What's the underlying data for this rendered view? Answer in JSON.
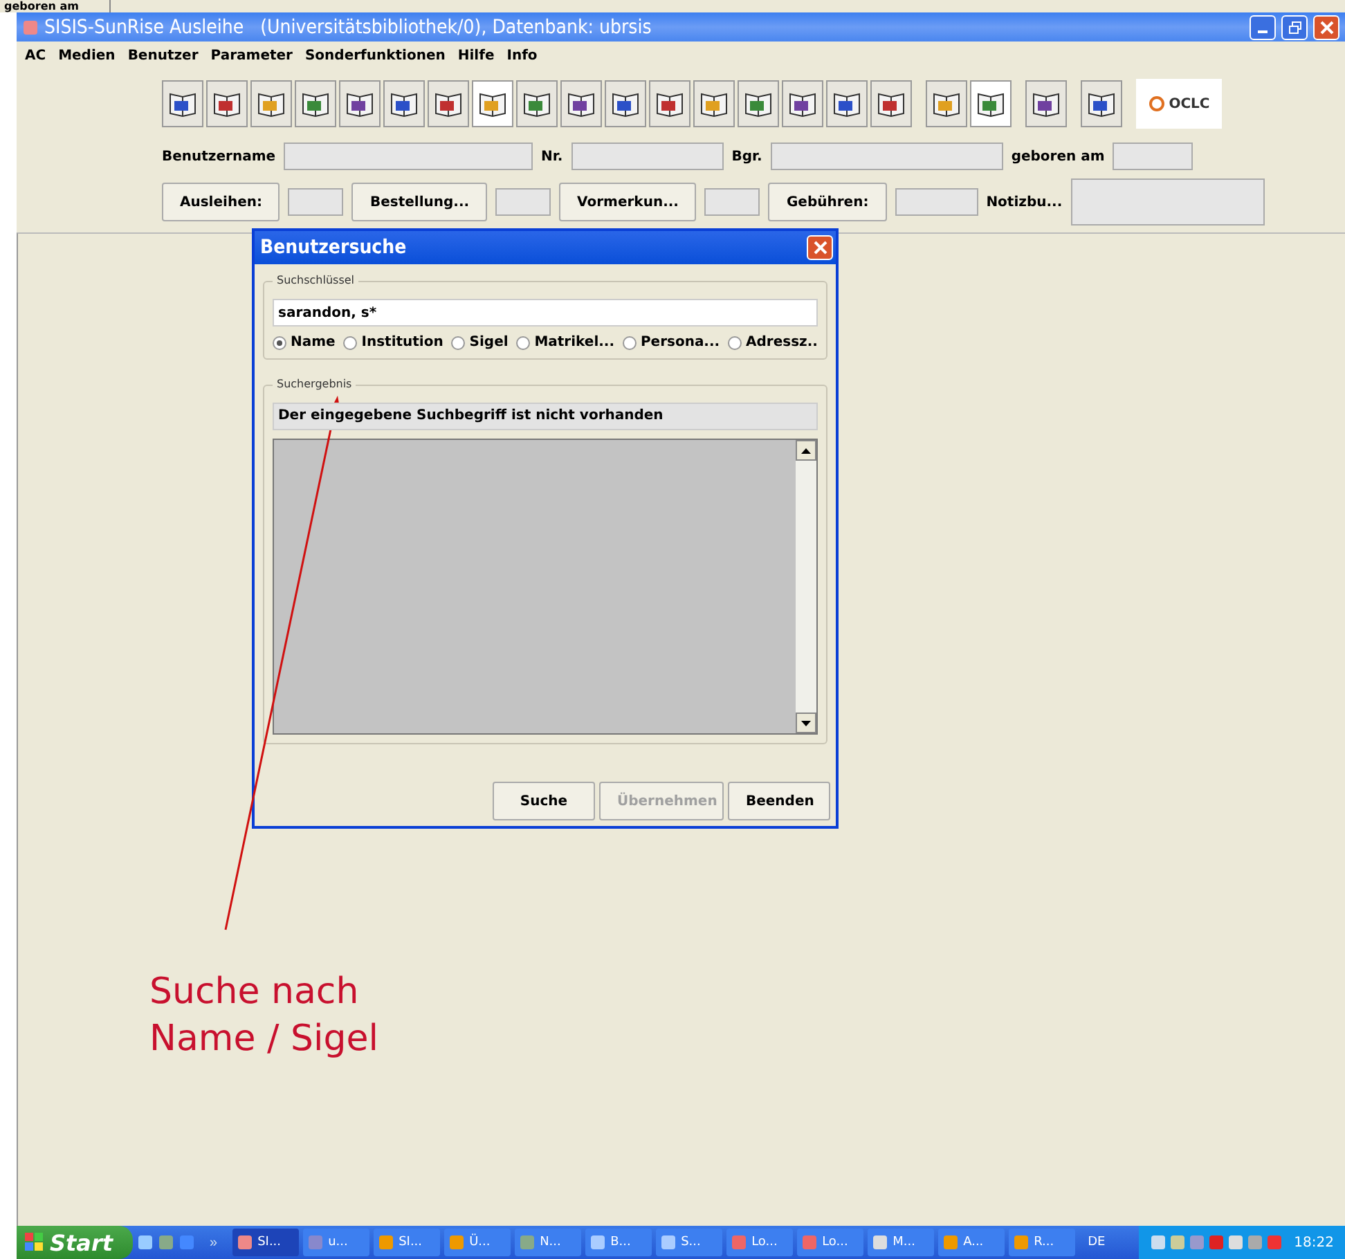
{
  "background_window": {
    "label": "geboren am"
  },
  "window": {
    "title": "SISIS-SunRise Ausleihe   (Universitätsbibliothek/0), Datenbank: ubrsis"
  },
  "menu": [
    "AC",
    "Medien",
    "Benutzer",
    "Parameter",
    "Sonderfunktionen",
    "Hilfe",
    "Info"
  ],
  "toolbar": [
    {
      "pressed": false
    },
    {
      "pressed": false
    },
    {
      "pressed": false
    },
    {
      "pressed": false
    },
    {
      "pressed": false
    },
    {
      "pressed": false
    },
    {
      "pressed": false
    },
    {
      "pressed": true
    },
    {
      "pressed": false
    },
    {
      "pressed": false
    },
    {
      "pressed": false
    },
    {
      "pressed": false
    },
    {
      "pressed": false
    },
    {
      "pressed": false
    },
    {
      "pressed": false
    },
    {
      "pressed": false
    },
    {
      "pressed": false
    },
    {
      "pressed": false
    },
    {
      "pressed": true
    },
    {
      "pressed": false
    },
    {
      "pressed": false
    }
  ],
  "logo": "OCLC",
  "user_fields": [
    {
      "label": "Benutzername"
    },
    {
      "label": "Nr."
    },
    {
      "label": "Bgr."
    },
    {
      "label": "geboren am"
    }
  ],
  "account_buttons": [
    {
      "label": "Ausleihen:"
    },
    {
      "label": "Bestellung..."
    },
    {
      "label": "Vormerkun..."
    },
    {
      "label": "Gebühren:"
    }
  ],
  "notes_label": "Notizbu...",
  "dialog": {
    "title": "Benutzersuche",
    "search_group": "Suchschlüssel",
    "search_value": "sarandon, s*",
    "options": [
      {
        "label": "Name",
        "selected": true
      },
      {
        "label": "Institution",
        "selected": false
      },
      {
        "label": "Sigel",
        "selected": false
      },
      {
        "label": "Matrikel...",
        "selected": false
      },
      {
        "label": "Persona...",
        "selected": false
      },
      {
        "label": "Adressz..",
        "selected": false
      }
    ],
    "result_group": "Suchergebnis",
    "message": "Der eingegebene Suchbegriff ist nicht vorhanden",
    "buttons": [
      {
        "label": "Suche",
        "disabled": false
      },
      {
        "label": "Übernehmen",
        "disabled": true
      },
      {
        "label": "Beenden",
        "disabled": false
      }
    ]
  },
  "annotation": [
    "Suche nach",
    "Name / Sigel"
  ],
  "taskbar": {
    "start": "Start",
    "quick_launch_more": "»",
    "tasks": [
      {
        "label": "SI...",
        "selected": true
      },
      {
        "label": "u...",
        "selected": false
      },
      {
        "label": "SI...",
        "selected": false
      },
      {
        "label": "Ü...",
        "selected": false
      },
      {
        "label": "N...",
        "selected": false
      },
      {
        "label": "B...",
        "selected": false
      },
      {
        "label": "S...",
        "selected": false
      },
      {
        "label": "Lo...",
        "selected": false
      },
      {
        "label": "Lo...",
        "selected": false
      },
      {
        "label": "M...",
        "selected": false
      },
      {
        "label": "A...",
        "selected": false
      },
      {
        "label": "R...",
        "selected": false
      }
    ],
    "language": "DE",
    "clock": "18:22"
  }
}
